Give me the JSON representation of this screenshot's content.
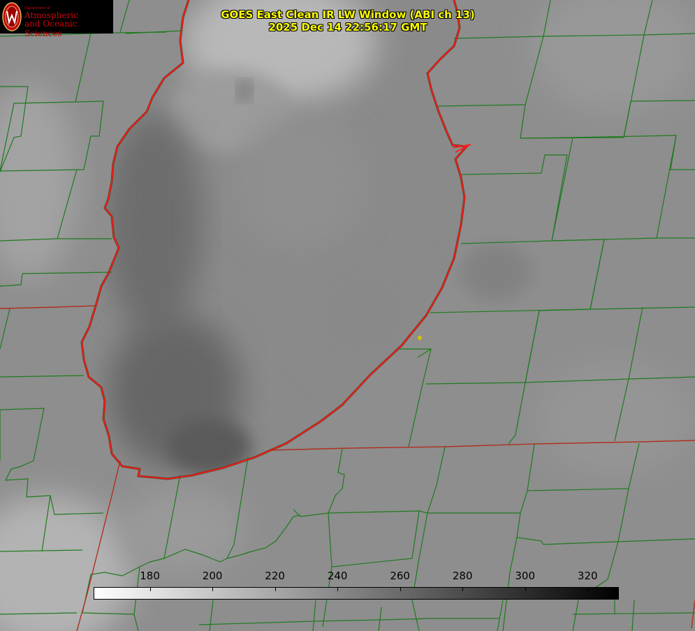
{
  "title": {
    "line1": "GOES East Clean IR LW Window (ABI ch 13)",
    "line2": "2025 Dec 14 22:56:17 GMT"
  },
  "logo": {
    "dept": "Department of",
    "line1": "Atmospheric",
    "line2": "and Oceanic Sciences",
    "brand_color": "#c5050c"
  },
  "colorbar": {
    "min": 162,
    "max": 330,
    "ticks": [
      "180",
      "200",
      "220",
      "240",
      "260",
      "280",
      "300",
      "320"
    ],
    "colormap": "white-to-black (inverted grayscale)"
  },
  "map": {
    "region": "Lake Michigan",
    "lake_outline_color": "#ff1a1a",
    "county_line_color": "#1f7a1f",
    "state_line_color": "#b03020",
    "marker_color": "#d4c400"
  }
}
